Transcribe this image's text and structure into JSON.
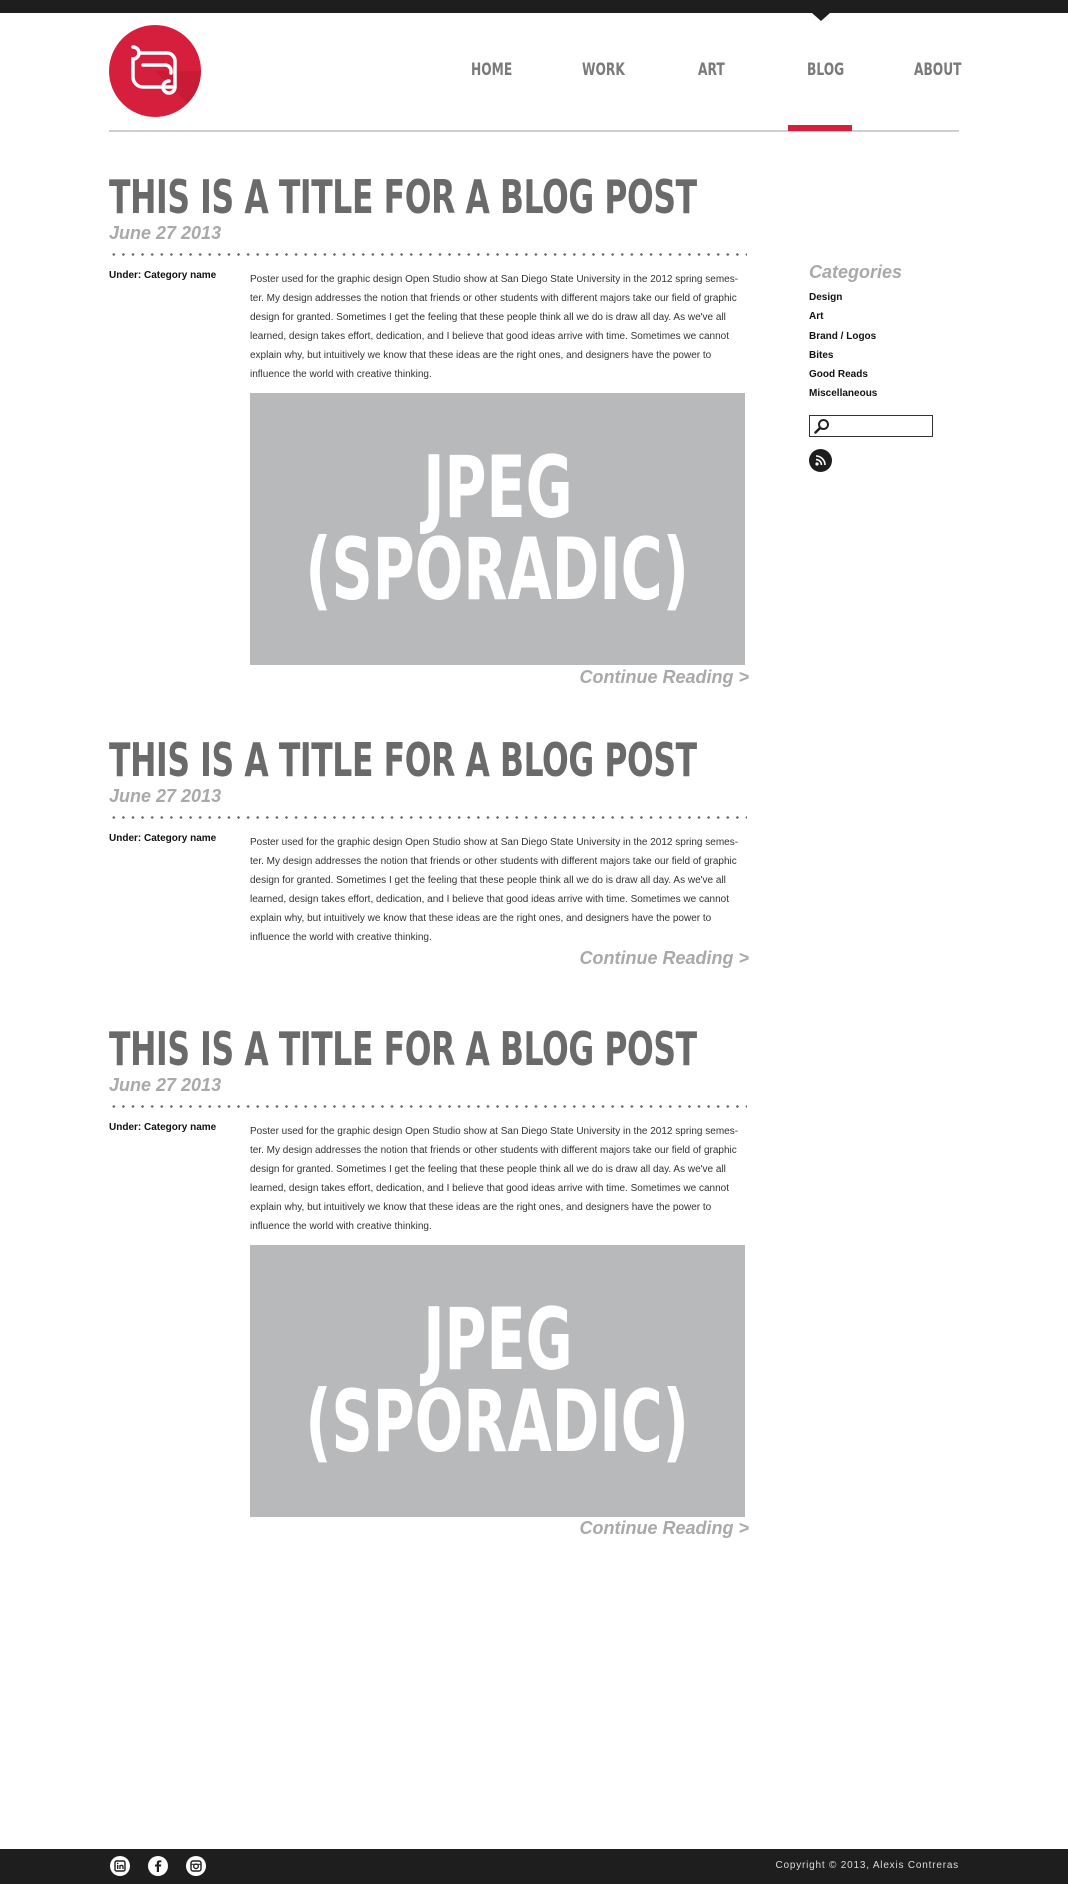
{
  "nav": {
    "items": [
      {
        "label": "HOME"
      },
      {
        "label": "WORK"
      },
      {
        "label": "ART"
      },
      {
        "label": "BLOG"
      },
      {
        "label": "ABOUT"
      }
    ],
    "active": "BLOG"
  },
  "posts": [
    {
      "title": "THIS IS A TITLE FOR A BLOG POST",
      "date": "June 27 2013",
      "category": "Under: Category name",
      "body": "Poster used for the graphic design Open Studio show at San Diego State University in the 2012 spring semes-ter. My design addresses the notion that friends or other students with different majors take our field of graphic design for granted. Sometimes I get the feeling that these people think all we do is draw all day. As we've all learned, design takes effort, dedication, and I believe that good ideas arrive with time. Sometimes we cannot explain why, but intuitively we know that these ideas are the right ones, and designers have the power to influence the world with creative thinking.",
      "image_line1": "JPEG",
      "image_line2": "(SPORADIC)",
      "continue": "Continue Reading >"
    },
    {
      "title": "THIS IS A TITLE FOR A BLOG POST",
      "date": "June 27 2013",
      "category": "Under: Category name",
      "body": "Poster used for the graphic design Open Studio show at San Diego State University in the 2012 spring semes-ter. My design addresses the notion that friends or other students with different majors take our field of graphic design for granted. Sometimes I get the feeling that these people think all we do is draw all day. As we've all learned, design takes effort, dedication, and I believe that good ideas arrive with time. Sometimes we cannot explain why, but intuitively we know that these ideas are the right ones, and designers have the power to influence the world with creative thinking.",
      "continue": "Continue Reading >"
    },
    {
      "title": "THIS IS A TITLE FOR A BLOG POST",
      "date": "June 27 2013",
      "category": "Under: Category name",
      "body": "Poster used for the graphic design Open Studio show at San Diego State University in the 2012 spring semes-ter. My design addresses the notion that friends or other students with different majors take our field of graphic design for granted. Sometimes I get the feeling that these people think all we do is draw all day. As we've all learned, design takes effort, dedication, and I believe that good ideas arrive with time. Sometimes we cannot explain why, but intuitively we know that these ideas are the right ones, and designers have the power to influence the world with creative thinking.",
      "image_line1": "JPEG",
      "image_line2": "(SPORADIC)",
      "continue": "Continue Reading >"
    }
  ],
  "sidebar": {
    "heading": "Categories",
    "categories": [
      "Design",
      "Art",
      "Brand / Logos",
      "Bites",
      "Good Reads",
      "Miscellaneous"
    ],
    "search_placeholder": ""
  },
  "footer": {
    "social": [
      "linkedin-icon",
      "facebook-icon",
      "instagram-icon"
    ],
    "copyright": "Copyright  © 2013, Alexis Contreras"
  },
  "colors": {
    "accent": "#d61f3d",
    "dark": "#1e1e1e",
    "title_gray": "#6a6a6a",
    "muted_gray": "#a9a9a9",
    "image_gray": "#b8b9bb"
  }
}
